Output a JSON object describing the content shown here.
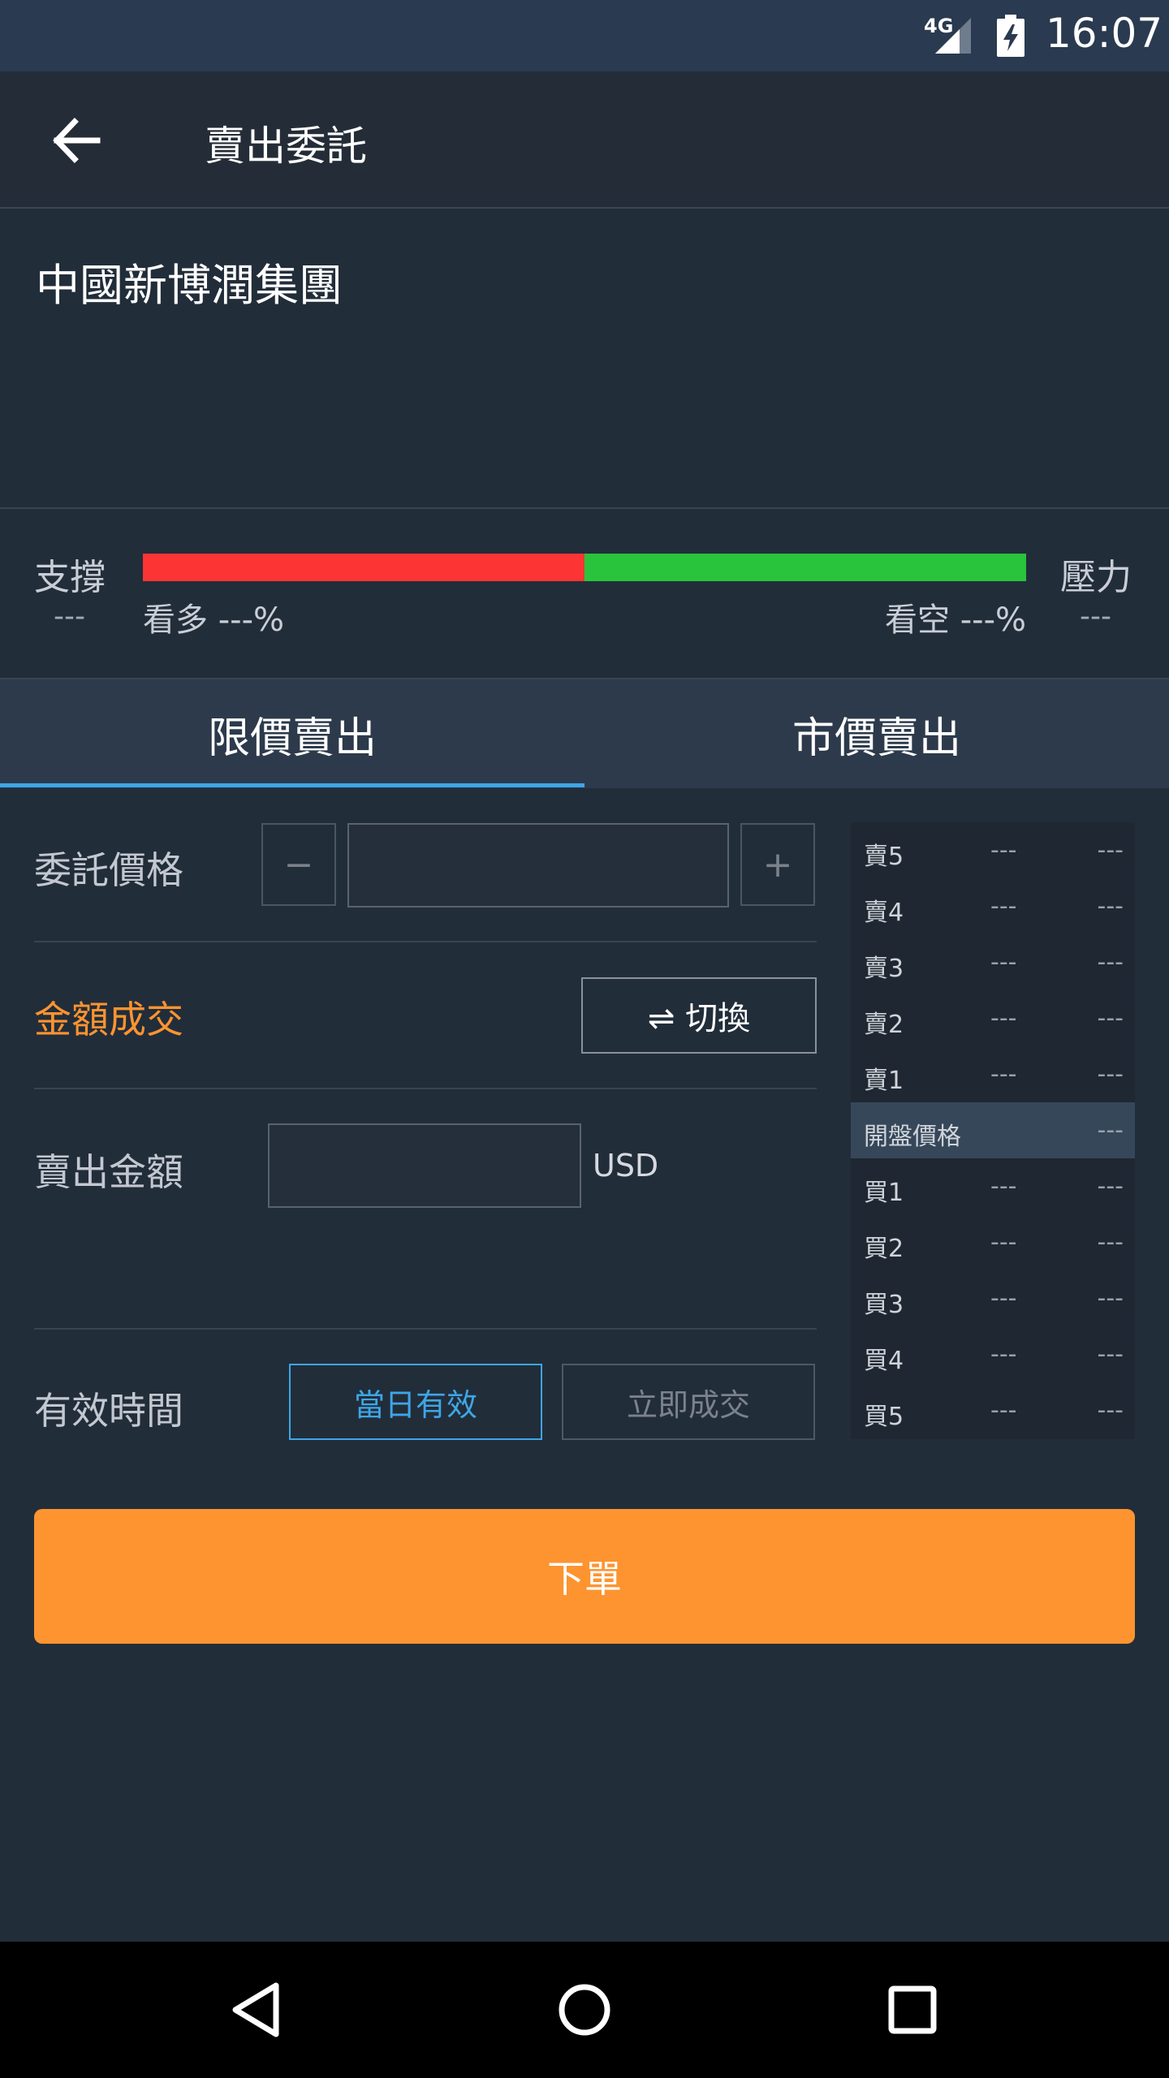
{
  "status_bar": {
    "network": "4G",
    "time": "16:07"
  },
  "app_bar": {
    "title": "賣出委託"
  },
  "stock": {
    "name": "中國新博潤集團"
  },
  "sentiment": {
    "support_label": "支撐",
    "support_value": "---",
    "resistance_label": "壓力",
    "resistance_value": "---",
    "bull_text": "看多 ---%",
    "bear_text": "看空 ---%",
    "bull_fraction": 0.5,
    "bull_color": "#fc3534",
    "bear_color": "#29c43b"
  },
  "tabs": [
    {
      "label": "限價賣出",
      "selected": true
    },
    {
      "label": "市價賣出",
      "selected": false
    }
  ],
  "form": {
    "price_label": "委託價格",
    "minus": "−",
    "plus": "+",
    "amount_trade_label": "金額成交",
    "switch_label": "⇌ 切換",
    "sell_amount_label": "賣出金額",
    "currency": "USD",
    "validity_label": "有效時間",
    "validity_options": [
      {
        "label": "當日有效",
        "selected": true
      },
      {
        "label": "立即成交",
        "selected": false
      }
    ]
  },
  "order_book": {
    "sell": [
      {
        "label": "賣5",
        "v1": "---",
        "v2": "---"
      },
      {
        "label": "賣4",
        "v1": "---",
        "v2": "---"
      },
      {
        "label": "賣3",
        "v1": "---",
        "v2": "---"
      },
      {
        "label": "賣2",
        "v1": "---",
        "v2": "---"
      },
      {
        "label": "賣1",
        "v1": "---",
        "v2": "---"
      }
    ],
    "open": {
      "label": "開盤價格",
      "value": "---"
    },
    "buy": [
      {
        "label": "買1",
        "v1": "---",
        "v2": "---"
      },
      {
        "label": "買2",
        "v1": "---",
        "v2": "---"
      },
      {
        "label": "買3",
        "v1": "---",
        "v2": "---"
      },
      {
        "label": "買4",
        "v1": "---",
        "v2": "---"
      },
      {
        "label": "買5",
        "v1": "---",
        "v2": "---"
      }
    ]
  },
  "submit": {
    "label": "下單"
  },
  "colors": {
    "accent_orange": "#fd9430",
    "tab_underline": "#3ea6e6",
    "selected_blue": "#3ea6e6"
  },
  "icons": {
    "back": "arrow-left-icon",
    "nav_back": "triangle-back-icon",
    "nav_home": "circle-home-icon",
    "nav_recents": "square-recents-icon"
  }
}
